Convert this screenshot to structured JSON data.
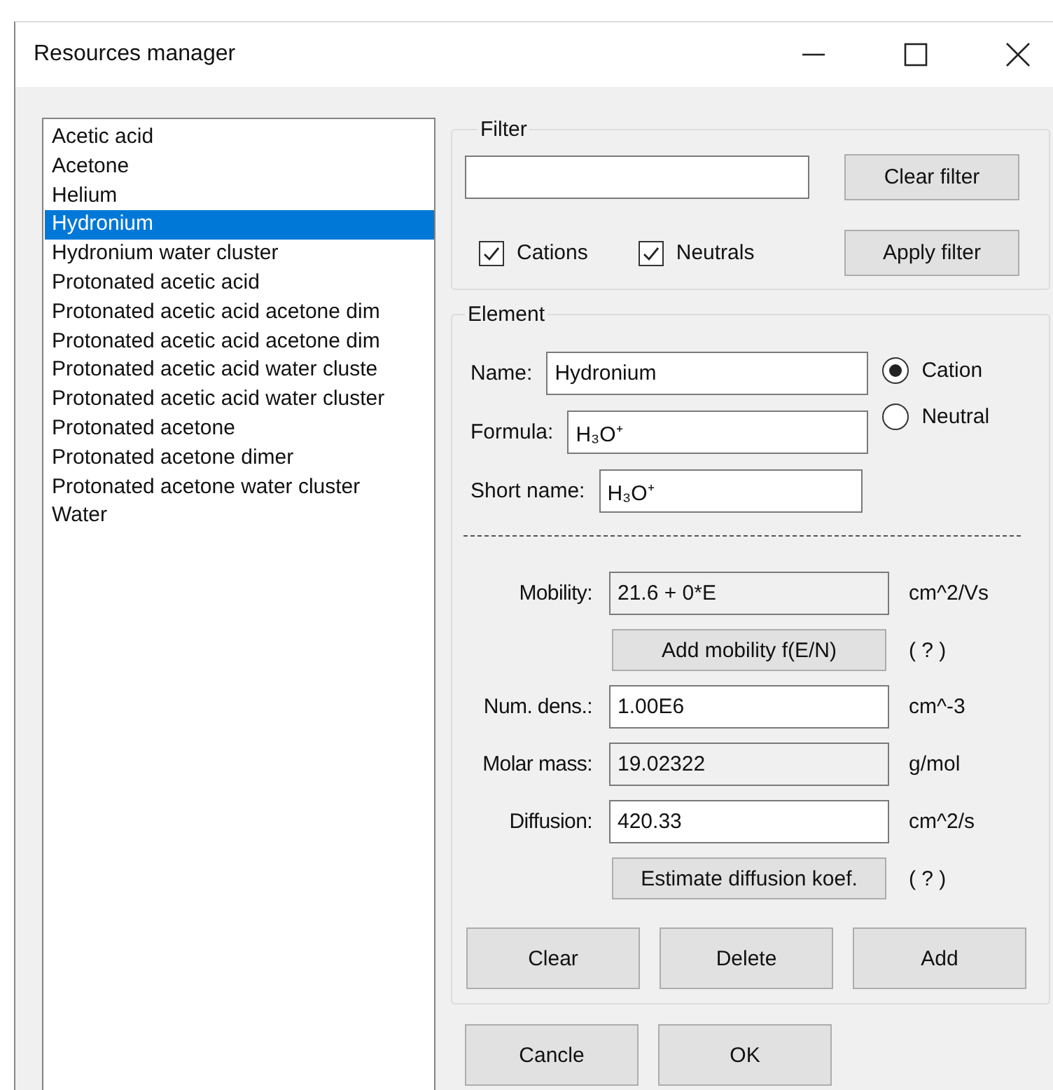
{
  "window": {
    "title": "Resources manager"
  },
  "list": {
    "items": [
      {
        "label": "Acetic acid",
        "selected": false
      },
      {
        "label": "Acetone",
        "selected": false
      },
      {
        "label": "Helium",
        "selected": false
      },
      {
        "label": "Hydronium",
        "selected": true
      },
      {
        "label": "Hydronium water cluster",
        "selected": false
      },
      {
        "label": "Protonated acetic acid",
        "selected": false
      },
      {
        "label": "Protonated acetic acid acetone dim",
        "selected": false
      },
      {
        "label": "Protonated acetic acid acetone dim",
        "selected": false
      },
      {
        "label": "Protonated acetic acid water cluste",
        "selected": false
      },
      {
        "label": "Protonated acetic acid water cluster",
        "selected": false
      },
      {
        "label": "Protonated acetone",
        "selected": false
      },
      {
        "label": "Protonated acetone dimer",
        "selected": false
      },
      {
        "label": "Protonated acetone water cluster",
        "selected": false
      },
      {
        "label": "Water",
        "selected": false
      }
    ]
  },
  "filter": {
    "legend": "Filter",
    "clear_button": "Clear filter",
    "apply_button": "Apply filter",
    "checkboxes": [
      {
        "label": "Cations",
        "checked": true
      },
      {
        "label": "Neutrals",
        "checked": true
      }
    ]
  },
  "element": {
    "legend": "Element",
    "fields": [
      {
        "label": "Name:",
        "value": "Hydronium"
      },
      {
        "label": "Formula:",
        "value": "H₃O⁺"
      },
      {
        "label": "Short name:",
        "value": "H₃O⁺"
      }
    ],
    "type_options": [
      {
        "label": "Cation",
        "selected": true
      },
      {
        "label": "Neutral",
        "selected": false
      }
    ],
    "properties": [
      {
        "kind": "field",
        "label": "Mobility:",
        "value": "21.6 + 0*E",
        "unit": "cm^2/Vs",
        "readonly": true
      },
      {
        "kind": "button",
        "label": "Add mobility f(E/N)",
        "hint": "( ? )"
      },
      {
        "kind": "field",
        "label": "Num. dens.:",
        "value": "1.00E6",
        "unit": "cm^-3",
        "readonly": false
      },
      {
        "kind": "field",
        "label": "Molar mass:",
        "value": "19.02322",
        "unit": "g/mol",
        "readonly": true
      },
      {
        "kind": "field",
        "label": "Diffusion:",
        "value": "420.33",
        "unit": "cm^2/s",
        "readonly": false
      },
      {
        "kind": "button",
        "label": "Estimate diffusion koef.",
        "hint": "( ? )"
      }
    ],
    "buttons": [
      "Clear",
      "Delete",
      "Add"
    ]
  },
  "dialog_buttons": [
    "Cancle",
    "OK"
  ]
}
